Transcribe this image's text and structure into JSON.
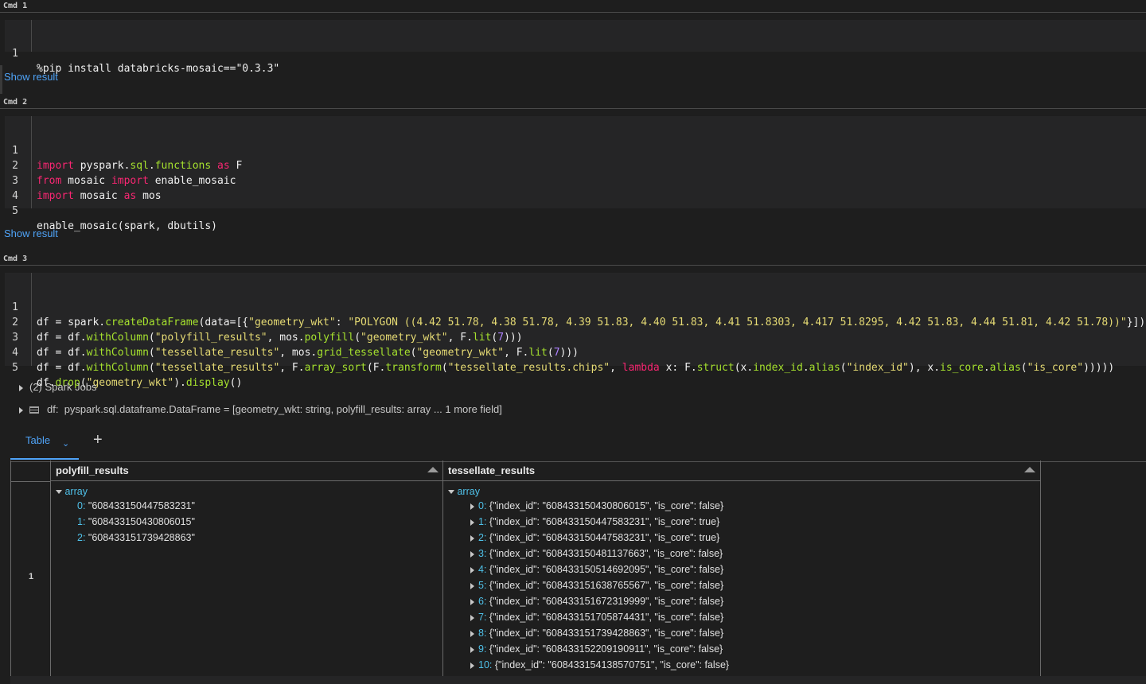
{
  "cells": [
    {
      "label": "Cmd 1",
      "lines": [
        "1"
      ],
      "show_result": "Show result"
    },
    {
      "label": "Cmd 2",
      "lines": [
        "1",
        "2",
        "3",
        "4",
        "5"
      ],
      "show_result": "Show result"
    },
    {
      "label": "Cmd 3",
      "lines": [
        "1",
        "2",
        "3",
        "4",
        "5"
      ]
    }
  ],
  "code": {
    "cmd1": [
      "%pip install databricks-mosaic==\"0.3.3\""
    ],
    "cmd2": [
      "import pyspark.sql.functions as F",
      "from mosaic import enable_mosaic",
      "import mosaic as mos",
      "",
      "enable_mosaic(spark, dbutils)"
    ],
    "cmd3": [
      "df = spark.createDataFrame(data=[{\"geometry_wkt\": \"POLYGON ((4.42 51.78, 4.38 51.78, 4.39 51.83, 4.40 51.83, 4.41 51.8303, 4.417 51.8295, 4.42 51.83, 4.44 51.81, 4.42 51.78))\"}])",
      "df = df.withColumn(\"polyfill_results\", mos.polyfill(\"geometry_wkt\", F.lit(7)))",
      "df = df.withColumn(\"tessellate_results\", mos.grid_tessellate(\"geometry_wkt\", F.lit(7)))",
      "df = df.withColumn(\"tessellate_results\", F.array_sort(F.transform(\"tessellate_results.chips\", lambda x: F.struct(x.index_id.alias(\"index_id\"), x.is_core.alias(\"is_core\")))))",
      "df.drop(\"geometry_wkt\").display()"
    ]
  },
  "spark_jobs": "(2) Spark Jobs",
  "df_info": {
    "name": "df:",
    "schema": "pyspark.sql.dataframe.DataFrame = [geometry_wkt: string, polyfill_results: array ... 1 more field]"
  },
  "tabs": {
    "table": "Table",
    "add": "+"
  },
  "table": {
    "columns": [
      "polyfill_results",
      "tessellate_results"
    ],
    "row_number": "1",
    "array_label": "array",
    "polyfill": [
      {
        "idx": "0:",
        "val": "\"608433150447583231\""
      },
      {
        "idx": "1:",
        "val": "\"608433150430806015\""
      },
      {
        "idx": "2:",
        "val": "\"608433151739428863\""
      }
    ],
    "tessellate": [
      {
        "idx": "0:",
        "val": "{\"index_id\": \"608433150430806015\", \"is_core\": false}"
      },
      {
        "idx": "1:",
        "val": "{\"index_id\": \"608433150447583231\", \"is_core\": true}"
      },
      {
        "idx": "2:",
        "val": "{\"index_id\": \"608433150447583231\", \"is_core\": true}"
      },
      {
        "idx": "3:",
        "val": "{\"index_id\": \"608433150481137663\", \"is_core\": false}"
      },
      {
        "idx": "4:",
        "val": "{\"index_id\": \"608433150514692095\", \"is_core\": false}"
      },
      {
        "idx": "5:",
        "val": "{\"index_id\": \"608433151638765567\", \"is_core\": false}"
      },
      {
        "idx": "6:",
        "val": "{\"index_id\": \"608433151672319999\", \"is_core\": false}"
      },
      {
        "idx": "7:",
        "val": "{\"index_id\": \"608433151705874431\", \"is_core\": false}"
      },
      {
        "idx": "8:",
        "val": "{\"index_id\": \"608433151739428863\", \"is_core\": false}"
      },
      {
        "idx": "9:",
        "val": "{\"index_id\": \"608433152209190911\", \"is_core\": false}"
      },
      {
        "idx": "10:",
        "val": "{\"index_id\": \"608433154138570751\", \"is_core\": false}"
      }
    ]
  }
}
